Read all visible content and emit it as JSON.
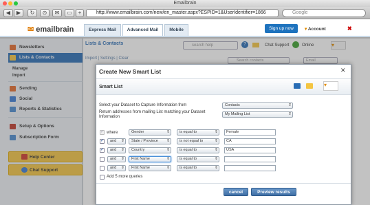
{
  "window": {
    "title": "Emailbrain"
  },
  "browser": {
    "url": "http://www.emailbrain.com/new/en_master.aspx?ESPID=1&UserIdentifier=1866",
    "search_placeholder": "Google"
  },
  "app": {
    "logo_text": "emailbrain",
    "tabs": [
      "Express Mail",
      "Advanced Mail",
      "Mobile"
    ],
    "signup_label": "Sign up now",
    "account_label": "Account"
  },
  "sidebar": {
    "items": [
      {
        "label": "Newsletters",
        "color": "#e36b2c"
      },
      {
        "label": "Lists & Contacts",
        "color": "#f4c542",
        "active": true
      },
      {
        "label": "Sending",
        "color": "#e36b2c"
      },
      {
        "label": "Social",
        "color": "#3b7bd5"
      },
      {
        "label": "Reports & Statistics",
        "color": "#4a8ad0"
      },
      {
        "label": "Setup & Options",
        "color": "#c0392b"
      },
      {
        "label": "Subscription Form",
        "color": "#4a8ad0"
      }
    ],
    "subitems": [
      "Manage",
      "Import"
    ],
    "promos": [
      "Help Center",
      "Chat Support"
    ]
  },
  "main": {
    "title": "Lists & Contacts",
    "help_search_placeholder": "search help",
    "chat_support": "Chat Support",
    "online": "Online",
    "toolbar_links": "Import | Settings | Clear",
    "search_contacts_placeholder": "Search contacts",
    "email_select": "Email"
  },
  "modal": {
    "title": "Create New Smart List",
    "section_title": "Smart List",
    "dataset_label": "Select your Dataset to Capture Information from",
    "dataset_value": "Contacts",
    "return_label": "Return addresses from mailing List matching your Dataset Information",
    "list_value": "My Mailing List",
    "where_label": "where",
    "rows": [
      {
        "checked": true,
        "disabled": true,
        "connector": "",
        "field": "Gender",
        "op": "is equal to",
        "value": "Female"
      },
      {
        "checked": true,
        "disabled": false,
        "connector": "and",
        "field": "State / Province",
        "op": "is not equal to",
        "value": "CA"
      },
      {
        "checked": true,
        "disabled": false,
        "connector": "and",
        "field": "Country",
        "op": "is equal to",
        "value": "USA"
      },
      {
        "checked": false,
        "disabled": false,
        "connector": "and",
        "field": "First Name",
        "op": "is equal to",
        "value": "",
        "focus": true
      },
      {
        "checked": false,
        "disabled": false,
        "connector": "and",
        "field": "First Name",
        "op": "is equal to",
        "value": ""
      }
    ],
    "add_more_label": "Add 5 more queries",
    "cancel_label": "cancel",
    "preview_label": "Preview results"
  }
}
